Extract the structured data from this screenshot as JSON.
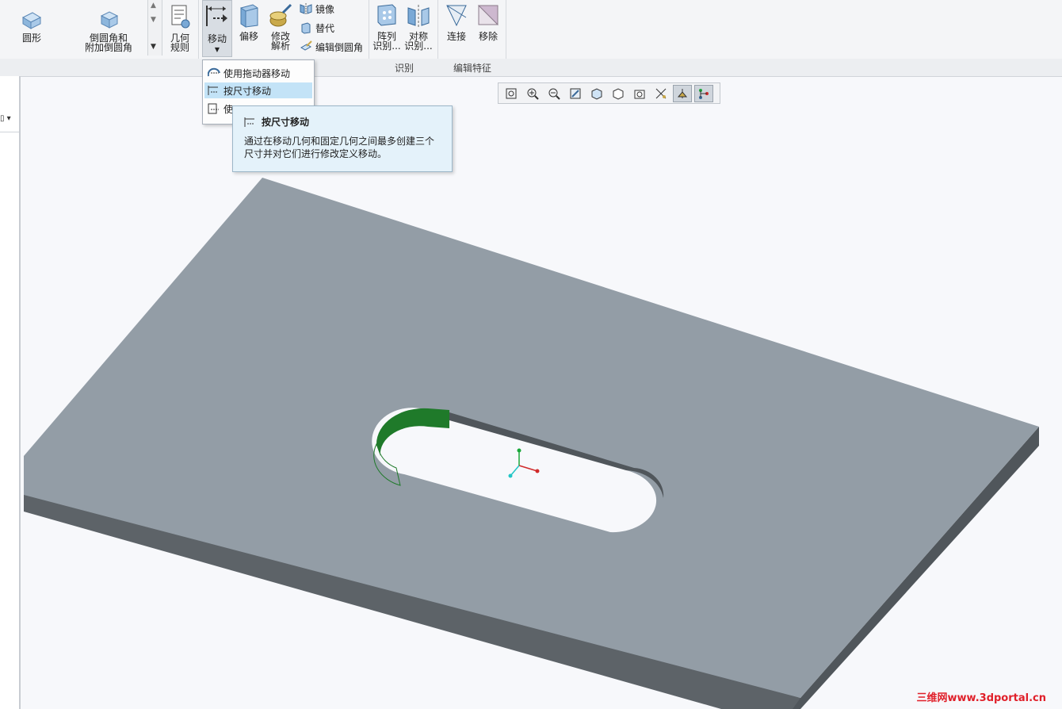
{
  "ribbon": {
    "buttons": {
      "round": "圆形",
      "round_ext_l1": "倒圆角和",
      "round_ext_l2": "附加倒圆角",
      "geom_rule_l1": "几何",
      "geom_rule_l2": "规则",
      "move": "移动",
      "offset": "偏移",
      "modify_l1": "修改",
      "modify_l2": "解析",
      "mirror": "镜像",
      "substitute": "替代",
      "edit_round": "编辑倒圆角",
      "pattern_l1": "阵列",
      "pattern_l2": "识别...",
      "symmetry_l1": "对称",
      "symmetry_l2": "识别...",
      "attach": "连接",
      "remove": "移除"
    },
    "groups": {
      "recognition": "识别",
      "edit_feature": "编辑特征"
    }
  },
  "move_menu": {
    "items": [
      "使用拖动器移动",
      "按尺寸移动",
      "使"
    ]
  },
  "tooltip": {
    "title": "按尺寸移动",
    "body_l1": "通过在移动几何和固定几何之间最多创建三个",
    "body_l2": "尺寸并对它们进行修改定义移动。"
  },
  "watermark": "三维网www.3dportal.cn",
  "colors": {
    "plate_top": "#939da6",
    "plate_side": "#50565b",
    "plate_front": "#5d6368",
    "selection_green": "#1f7a2a",
    "tooltip_bg": "#e4f2fa",
    "menu_highlight": "#c3e3f7"
  }
}
